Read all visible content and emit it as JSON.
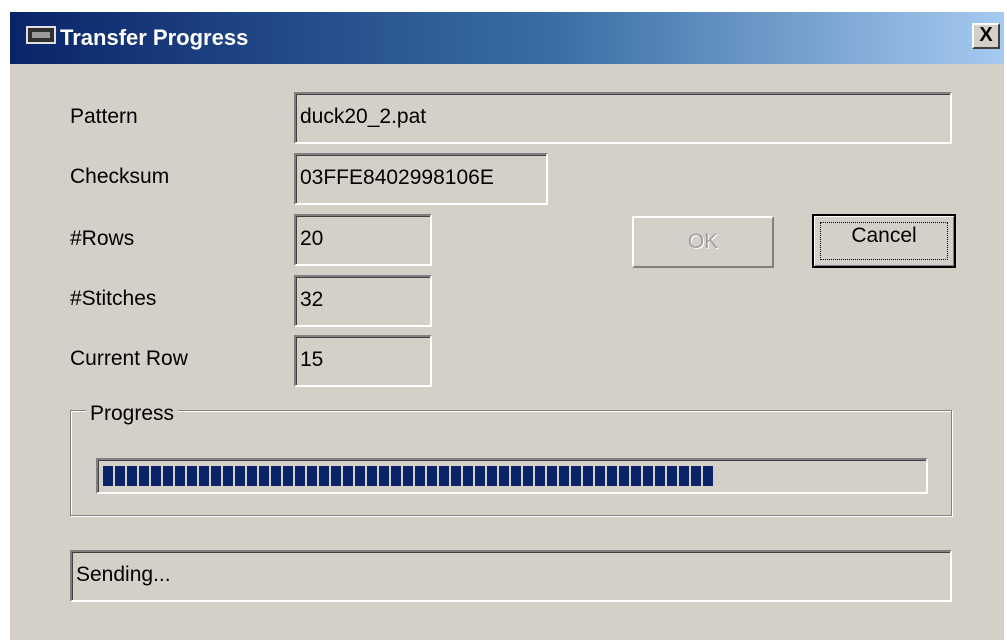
{
  "window": {
    "title": "Transfer Progress",
    "close_label": "X"
  },
  "fields": {
    "pattern": {
      "label": "Pattern",
      "value": "duck20_2.pat"
    },
    "checksum": {
      "label": "Checksum",
      "value": "03FFE8402998106E"
    },
    "rows": {
      "label": "#Rows",
      "value": "20"
    },
    "stitches": {
      "label": "#Stitches",
      "value": "32"
    },
    "current_row": {
      "label": "Current Row",
      "value": "15"
    }
  },
  "buttons": {
    "ok_label": "OK",
    "ok_enabled": false,
    "cancel_label": "Cancel"
  },
  "progress": {
    "group_label": "Progress",
    "fraction": 0.75,
    "bar_color": "#0a246a"
  },
  "status": {
    "text": "Sending..."
  },
  "colors": {
    "dialog_face": "#d4d0c8",
    "titlebar_start": "#0a246a",
    "titlebar_end": "#a6caf0"
  }
}
